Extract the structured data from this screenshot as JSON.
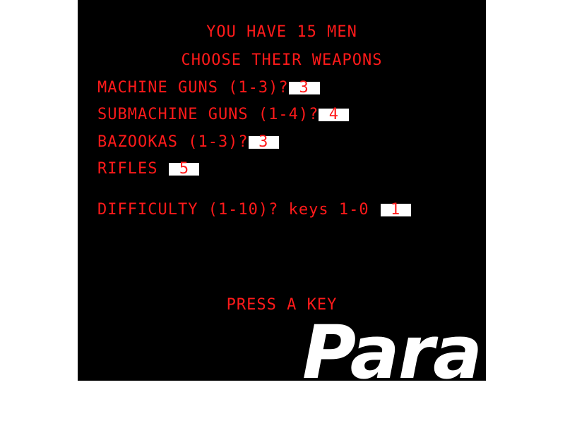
{
  "header": {
    "men_line": "YOU HAVE 15 MEN",
    "weapons_line": "CHOOSE THEIR WEAPONS"
  },
  "prompts": {
    "machine_guns": {
      "label": "MACHINE GUNS (1-3)?",
      "value": "3"
    },
    "submachine_guns": {
      "label": "SUBMACHINE GUNS (1-4)?",
      "value": "4"
    },
    "bazookas": {
      "label": "BAZOOKAS (1-3)?",
      "value": "3"
    },
    "rifles": {
      "label": "RIFLES",
      "value": "5"
    },
    "difficulty": {
      "label": "DIFFICULTY (1-10)? keys 1-0",
      "value": "1"
    }
  },
  "footer": {
    "press_key": "PRESS A KEY"
  },
  "logo": {
    "text": "Para"
  },
  "colors": {
    "screen_bg": "#000000",
    "text": "#ff1a1a",
    "input_bg": "#ffffff",
    "page_bg": "#ffffff"
  }
}
